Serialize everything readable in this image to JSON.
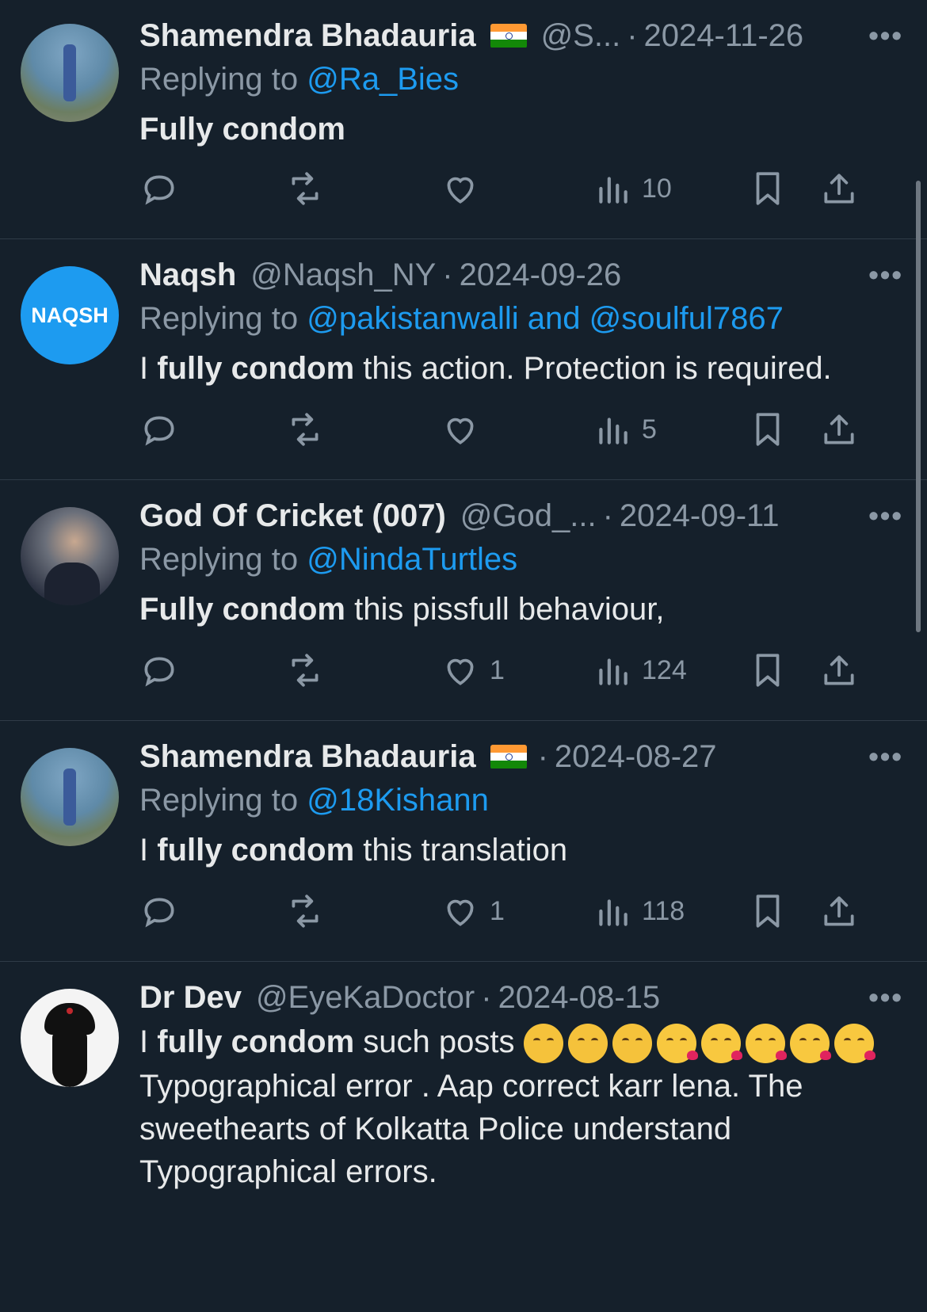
{
  "tweets": [
    {
      "name": "Shamendra Bhadauria",
      "flag": "india-flag",
      "handle": "@S...",
      "date": "2024-11-26",
      "reply_prefix": "Replying to",
      "reply_to": "@Ra_Bies",
      "text_bold": "Fully condom",
      "text_rest": "",
      "likes": "",
      "views": "10"
    },
    {
      "name": "Naqsh",
      "handle": "@Naqsh_NY",
      "date": "2024-09-26",
      "avatar_text": "NAQSH",
      "reply_prefix": "Replying to",
      "reply_to": "@pakistanwalli and @soulful7867",
      "text_pre": "I",
      "text_bold": "fully condom",
      "text_rest": "this action. Protection is required.",
      "likes": "",
      "views": "5"
    },
    {
      "name": "God Of Cricket (007)",
      "handle": "@God_...",
      "date": "2024-09-11",
      "reply_prefix": "Replying to",
      "reply_to": "@NindaTurtles",
      "text_bold": "Fully condom",
      "text_rest": "this pissfull behaviour,",
      "likes": "1",
      "views": "124"
    },
    {
      "name": "Shamendra Bhadauria",
      "flag": "india-flag",
      "date": "2024-08-27",
      "reply_prefix": "Replying to",
      "reply_to": "@18Kishann",
      "text_pre": "I",
      "text_bold": "fully condom",
      "text_rest": "this translation",
      "likes": "1",
      "views": "118"
    },
    {
      "name": "Dr Dev",
      "handle": "@EyeKaDoctor",
      "date": "2024-08-15",
      "text_pre": "I",
      "text_bold": "fully condom",
      "text_rest": "such posts",
      "emojis": [
        "pensive-face",
        "pensive-face",
        "pensive-face",
        "kissing-heart-face",
        "kissing-heart-face",
        "kissing-heart-face",
        "kissing-heart-face",
        "kissing-heart-face"
      ],
      "text_line2": "Typographical error . Aap correct karr lena. The sweethearts of Kolkatta Police understand Typographical errors."
    }
  ],
  "colors": {
    "background": "#15202b",
    "text": "#e7e9ea",
    "muted": "#8b98a5",
    "link": "#1d9bf0",
    "divider": "#2f3b47"
  }
}
